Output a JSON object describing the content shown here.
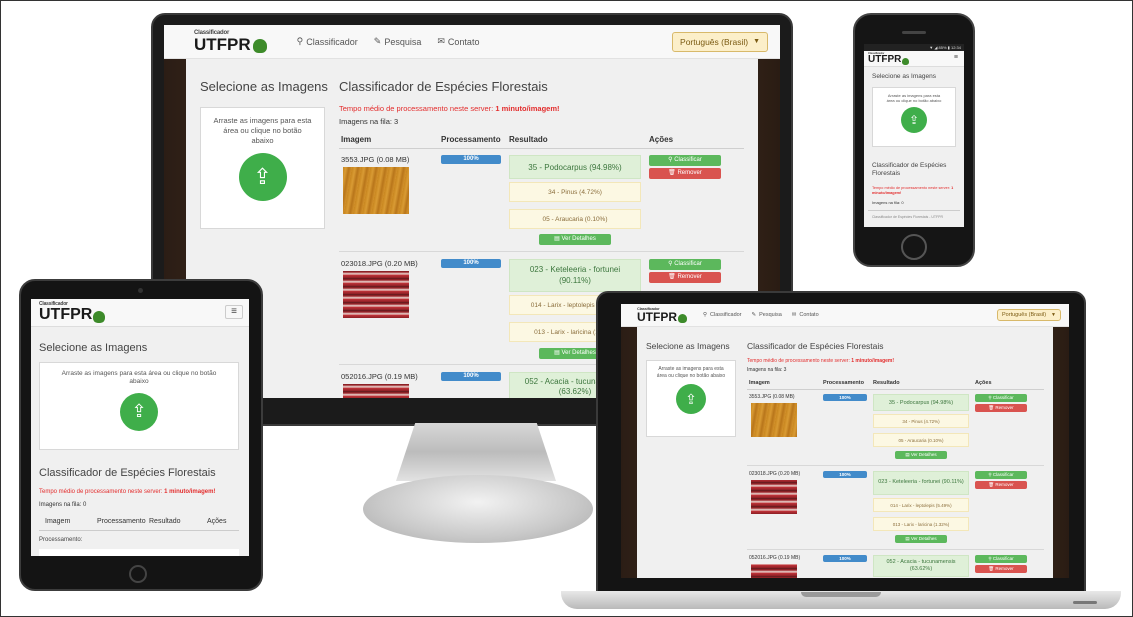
{
  "app": {
    "logo_top": "Classificador",
    "logo_main": "UTFPR",
    "nav_classificador": "Classificador",
    "nav_pesquisa": "Pesquisa",
    "nav_contato": "Contato",
    "language": "Português (Brasil)"
  },
  "upload": {
    "title": "Selecione as Imagens",
    "instructions_desktop": "Arraste as imagens para esta área ou clique no botão abaixo",
    "instructions_tablet": "Arraste as imagens para esta área ou clique no botão abaixo"
  },
  "classifier": {
    "title": "Classificador de Espécies Florestais",
    "avg_time_label": "Tempo médio de processamento neste server:",
    "avg_time_value": "1 minuto/imagem!",
    "queue_label_desktop": "Imagens na fila: 3",
    "queue_label_tablet": "Imagens na fila: 0",
    "columns": [
      "Imagem",
      "Processamento",
      "Resultado",
      "Ações"
    ],
    "classify_button": "Classificar",
    "remove_button": "Remover",
    "details_button": "Ver Detalhes",
    "processing_label": "Processamento:",
    "rows": [
      {
        "file": "3553.JPG (0.08 MB)",
        "progress_label": "100%",
        "progress": 1.0,
        "texture": "wood",
        "result_main": "35 - Podocarpus (94.98%)",
        "result_2": "34 - Pinus (4.72%)",
        "result_3": "05 - Araucaria (0.10%)"
      },
      {
        "file": "023018.JPG (0.20 MB)",
        "progress_label": "100%",
        "progress": 1.0,
        "texture": "bark",
        "result_main": "023 - Keteleeria - fortunei (90.11%)",
        "result_2": "014 - Larix - leptolepis (5.49%)",
        "result_3": "013 - Larix - laricina (1.32%)"
      },
      {
        "file": "052016.JPG (0.19 MB)",
        "progress_label": "100%",
        "progress": 1.0,
        "texture": "bark",
        "result_main": "052 - Acacia - tucunamensis (63.62%)"
      }
    ]
  },
  "phone": {
    "status": "▼ ◢ 85% ▮ 12:34",
    "footer": "Classificador de Espécies Florestais - UTFPR"
  },
  "colors": {
    "upload_green": "#3fae4a",
    "progress_blue": "#428bca",
    "result_green": "#dff0d8",
    "result_yellow": "#fcf8e3",
    "warning_red": "#e32d2d"
  }
}
